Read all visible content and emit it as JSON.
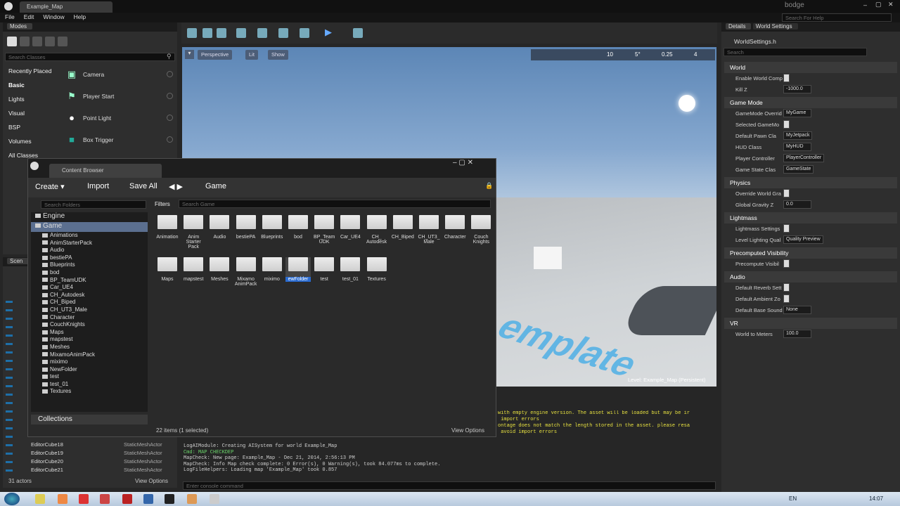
{
  "window": {
    "tab_title": "Example_Map",
    "search_help": "Search For Help",
    "user": "bodge"
  },
  "menu": [
    "File",
    "Edit",
    "Window",
    "Help"
  ],
  "modes": {
    "tab": "Modes",
    "search_placeholder": "Search Classes",
    "categories": [
      "Recently Placed",
      "Basic",
      "Lights",
      "Visual",
      "BSP",
      "Volumes",
      "All Classes"
    ],
    "items": [
      {
        "label": "Camera",
        "icon": "camera-icon"
      },
      {
        "label": "Player Start",
        "icon": "player-start-icon"
      },
      {
        "label": "Point Light",
        "icon": "light-bulb-icon"
      },
      {
        "label": "Box Trigger",
        "icon": "box-trigger-icon"
      }
    ]
  },
  "viewport": {
    "perspective": "Perspective",
    "lit": "Lit",
    "show": "Show",
    "grid_snap": "10",
    "rot_snap": "5°",
    "scale_snap": "0.25",
    "cam_speed": "4",
    "level_label": "Level:  Example_Map (Persistent)",
    "floor_text": "emplate"
  },
  "details": {
    "tab_details": "Details",
    "tab_world": "World Settings",
    "file": "WorldSettings.h",
    "search_placeholder": "Search",
    "sections": [
      {
        "title": "World",
        "rows": [
          [
            "Enable World Comp",
            ""
          ],
          [
            "Kill Z",
            "-1000.0"
          ]
        ]
      },
      {
        "title": "Game Mode",
        "rows": [
          [
            "GameMode Overrid",
            "MyGame"
          ],
          [
            "Selected GameMo",
            ""
          ],
          [
            "Default Pawn Cla",
            "MyJetpack"
          ],
          [
            "HUD Class",
            "MyHUD"
          ],
          [
            "Player Controller",
            "PlayerController"
          ],
          [
            "Game State Clas",
            "GameState"
          ]
        ]
      },
      {
        "title": "Physics",
        "rows": [
          [
            "Override World Gra",
            ""
          ],
          [
            "Global Gravity Z",
            "0.0"
          ]
        ]
      },
      {
        "title": "Lightmass",
        "rows": [
          [
            "Lightmass Settings",
            ""
          ],
          [
            "Level Lighting Qual",
            "Quality Preview"
          ]
        ]
      },
      {
        "title": "Precomputed Visibility",
        "rows": [
          [
            "Precompute Visibil",
            ""
          ]
        ]
      },
      {
        "title": "Audio",
        "rows": [
          [
            "Default Reverb Sett",
            ""
          ],
          [
            "Default Ambient Zo",
            ""
          ],
          [
            "Default Base Sound",
            "None"
          ]
        ]
      },
      {
        "title": "VR",
        "rows": [
          [
            "World to Meters",
            "100.0"
          ]
        ]
      }
    ]
  },
  "content_browser": {
    "tab": "Content Browser",
    "create": "Create",
    "import": "Import",
    "save_all": "Save All",
    "path": "Game",
    "search_folders": "Search Folders",
    "filters": "Filters",
    "search_game": "Search Game",
    "tree_roots": [
      "Engine",
      "Game"
    ],
    "tree_children": [
      "Animations",
      "AnimStarterPack",
      "Audio",
      "bestiePA",
      "Blueprints",
      "bod",
      "BP_TeamUDK",
      "Car_UE4",
      "CH_Autodesk",
      "CH_Biped",
      "CH_UT3_Male",
      "Character",
      "CouchKnights",
      "Maps",
      "mapstest",
      "Meshes",
      "MixamoAnimPack",
      "miximo",
      "NewFolder",
      "test",
      "test_01",
      "Textures"
    ],
    "assets_row1": [
      "Animation",
      "Anim Starter Pack",
      "Audio",
      "bestiePA",
      "Blueprints",
      "bod",
      "BP_Team UDK",
      "Car_UE4",
      "CH_ Autodesk",
      "CH_Biped",
      "CH_UT3_ Male",
      "Character",
      "Couch Knights"
    ],
    "assets_row2": [
      "Maps",
      "mapstest",
      "Meshes",
      "Mixamo AnimPack",
      "miximo",
      "ewFolder",
      "test",
      "test_01",
      "Textures"
    ],
    "collections": "Collections",
    "status": "22 items (1 selected)",
    "view_options": "View Options"
  },
  "scene": {
    "tab": "Scen",
    "rows": [
      [
        "EditorCube18",
        "StaticMeshActor"
      ],
      [
        "EditorCube19",
        "StaticMeshActor"
      ],
      [
        "EditorCube20",
        "StaticMeshActor"
      ],
      [
        "EditorCube21",
        "StaticMeshActor"
      ]
    ],
    "count": "31 actors",
    "view_options": "View Options"
  },
  "log": {
    "top_lines": [
      "with empty engine version. The asset will be loaded but may be ir",
      " import errors",
      "ontage does not match the length stored in the asset. please resa",
      " avoid import errors"
    ],
    "lines": [
      "LogAIModule: Creating AISystem for world Example_Map",
      "Cmd: MAP CHECKDEP",
      "MapCheck: New page: Example_Map - Dec 21, 2014, 2:56:13 PM",
      "MapCheck: Info Map check complete: 0 Error(s), 0 Warning(s), took 84.077ms to complete.",
      "LogFileHelpers: Loading map 'Example_Map' took 0.857"
    ],
    "console_placeholder": "Enter console command"
  },
  "taskbar": {
    "lang": "EN",
    "time": "14:07"
  }
}
